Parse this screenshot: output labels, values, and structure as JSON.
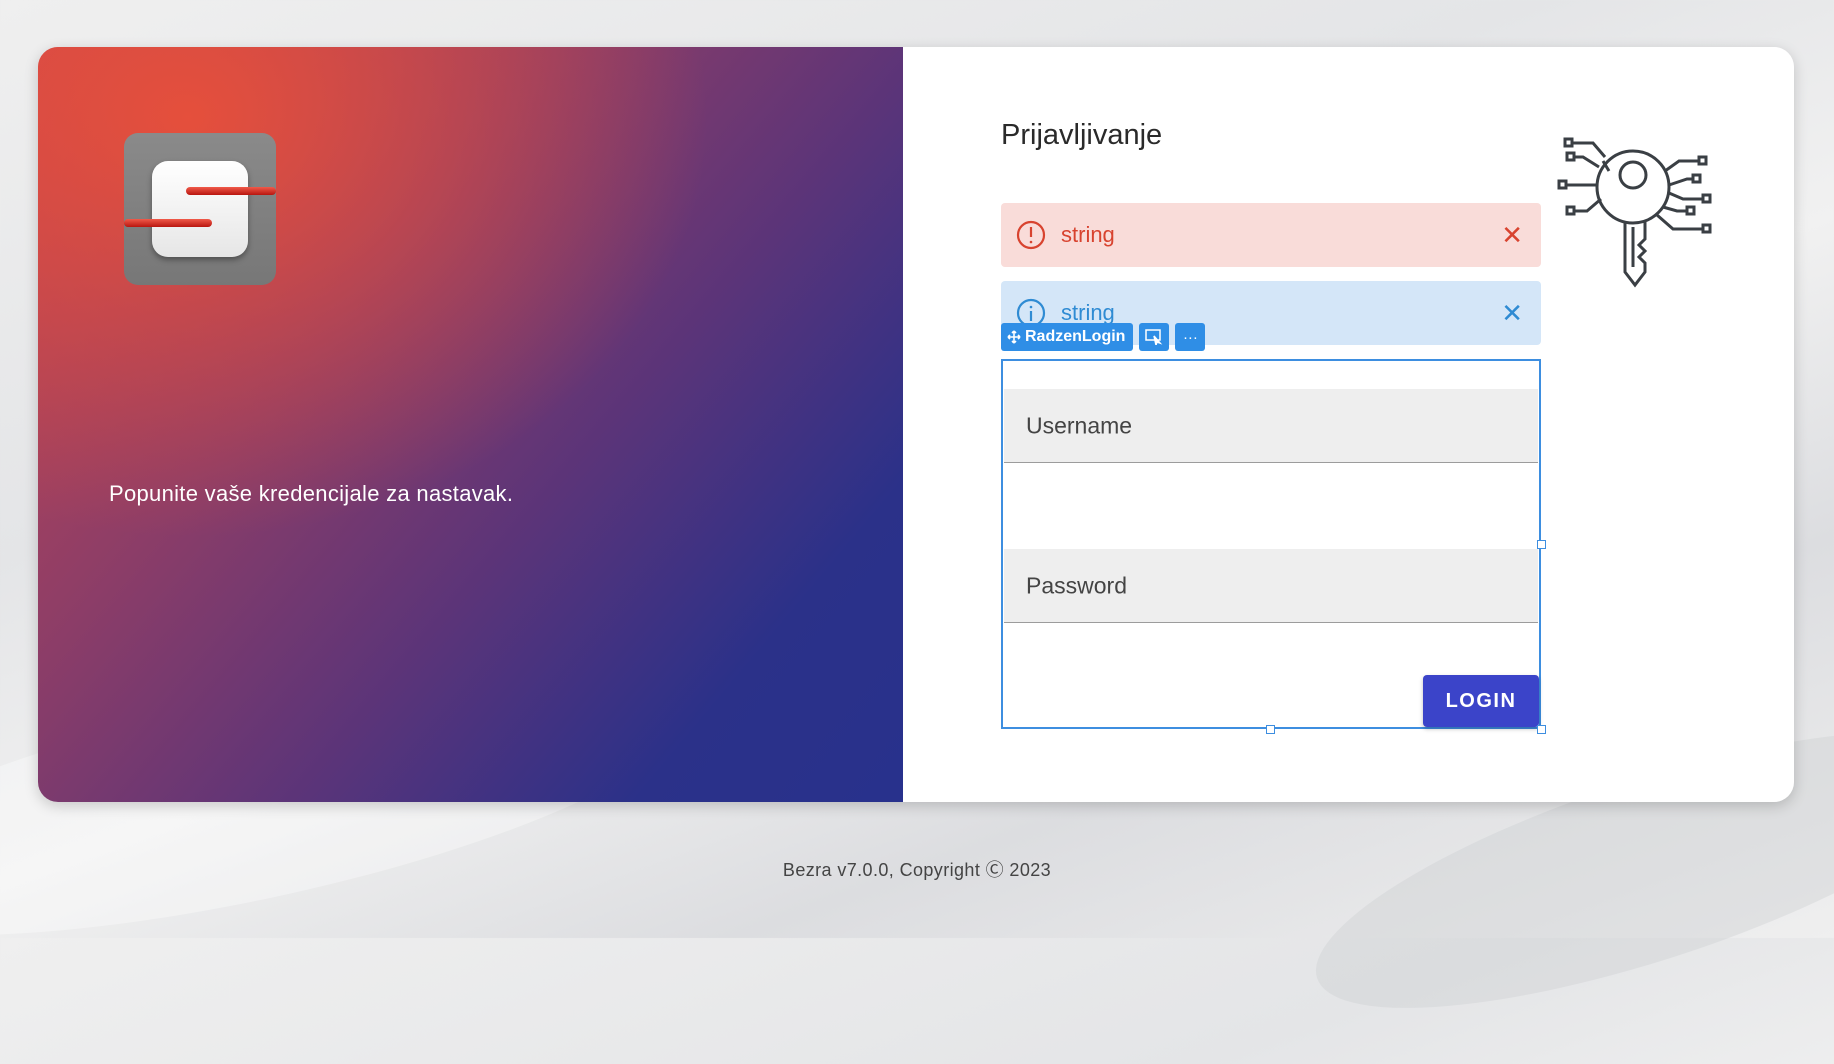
{
  "colors": {
    "accent": "#3b44c9",
    "danger_bg": "#f9dcd9",
    "danger_text": "#d8432f",
    "info_bg": "#d4e6f8",
    "info_text": "#2f8bd3",
    "designer_selection": "#3d8ee0"
  },
  "brand": {
    "logo_icon": "company-s-logo-icon",
    "tagline": "Popunite vaše kredencijale za nastavak."
  },
  "login": {
    "title": "Prijavljivanje",
    "illustration_icon": "circuit-key-icon",
    "alerts": [
      {
        "type": "danger",
        "icon": "exclamation-circle-icon",
        "text": "string",
        "close_icon": "close-icon"
      },
      {
        "type": "info",
        "icon": "info-circle-icon",
        "text": "string",
        "close_icon": "close-icon"
      }
    ],
    "designer": {
      "component_label": "RadzenLogin",
      "move_icon": "move-icon",
      "select_icon": "select-icon",
      "more_icon": "more-icon"
    },
    "username_placeholder": "Username",
    "password_placeholder": "Password",
    "login_label": "LOGIN"
  },
  "footer": {
    "text": "Bezra v7.0.0, Copyright Ⓒ 2023"
  }
}
